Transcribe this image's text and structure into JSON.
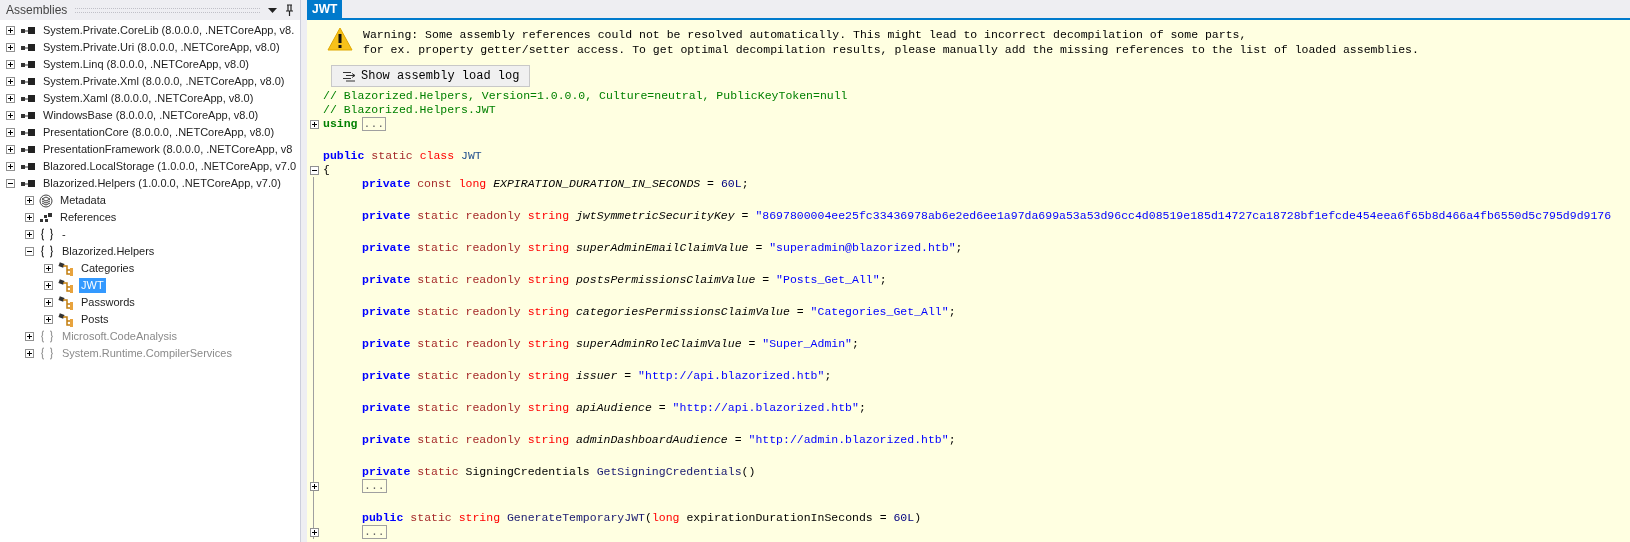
{
  "assemblies_panel": {
    "title": "Assemblies",
    "tree": [
      {
        "label": "System.Private.CoreLib (8.0.0.0, .NETCoreApp, v8.",
        "kind": "assembly",
        "expanded": false,
        "dimmed": false,
        "selected": false
      },
      {
        "label": "System.Private.Uri (8.0.0.0, .NETCoreApp, v8.0)",
        "kind": "assembly",
        "expanded": false,
        "dimmed": false,
        "selected": false
      },
      {
        "label": "System.Linq (8.0.0.0, .NETCoreApp, v8.0)",
        "kind": "assembly",
        "expanded": false,
        "dimmed": false,
        "selected": false
      },
      {
        "label": "System.Private.Xml (8.0.0.0, .NETCoreApp, v8.0)",
        "kind": "assembly",
        "expanded": false,
        "dimmed": false,
        "selected": false
      },
      {
        "label": "System.Xaml (8.0.0.0, .NETCoreApp, v8.0)",
        "kind": "assembly",
        "expanded": false,
        "dimmed": false,
        "selected": false
      },
      {
        "label": "WindowsBase (8.0.0.0, .NETCoreApp, v8.0)",
        "kind": "assembly",
        "expanded": false,
        "dimmed": false,
        "selected": false
      },
      {
        "label": "PresentationCore (8.0.0.0, .NETCoreApp, v8.0)",
        "kind": "assembly",
        "expanded": false,
        "dimmed": false,
        "selected": false
      },
      {
        "label": "PresentationFramework (8.0.0.0, .NETCoreApp, v8",
        "kind": "assembly",
        "expanded": false,
        "dimmed": false,
        "selected": false
      },
      {
        "label": "Blazored.LocalStorage (1.0.0.0, .NETCoreApp, v7.0",
        "kind": "assembly",
        "expanded": false,
        "dimmed": false,
        "selected": false
      },
      {
        "label": "Blazorized.Helpers (1.0.0.0, .NETCoreApp, v7.0)",
        "kind": "assembly",
        "expanded": true,
        "dimmed": false,
        "selected": false,
        "children": [
          {
            "label": "Metadata",
            "kind": "metadata",
            "expanded": false,
            "dimmed": false,
            "selected": false
          },
          {
            "label": "References",
            "kind": "references",
            "expanded": false,
            "dimmed": false,
            "selected": false
          },
          {
            "label": "-",
            "kind": "namespace",
            "expanded": false,
            "dimmed": false,
            "selected": false
          },
          {
            "label": "Blazorized.Helpers",
            "kind": "namespace",
            "expanded": true,
            "dimmed": false,
            "selected": false,
            "children": [
              {
                "label": "Categories",
                "kind": "class",
                "expanded": false,
                "dimmed": false,
                "selected": false
              },
              {
                "label": "JWT",
                "kind": "class",
                "expanded": false,
                "dimmed": false,
                "selected": true
              },
              {
                "label": "Passwords",
                "kind": "class",
                "expanded": false,
                "dimmed": false,
                "selected": false
              },
              {
                "label": "Posts",
                "kind": "class",
                "expanded": false,
                "dimmed": false,
                "selected": false
              }
            ]
          },
          {
            "label": "Microsoft.CodeAnalysis",
            "kind": "namespace",
            "expanded": false,
            "dimmed": true,
            "selected": false
          },
          {
            "label": "System.Runtime.CompilerServices",
            "kind": "namespace",
            "expanded": false,
            "dimmed": true,
            "selected": false
          }
        ]
      }
    ]
  },
  "editor": {
    "tabs": [
      {
        "label": "JWT",
        "selected": true
      }
    ],
    "warning": [
      "Warning: Some assembly references could not be resolved automatically. This might lead to incorrect decompilation of some parts,",
      "for ex. property getter/setter access. To get optimal decompilation results, please manually add the missing references to the list of loaded assemblies."
    ],
    "load_log_button": "Show assembly load log",
    "code": [
      {
        "kind": "code",
        "indented": false,
        "tokens": [
          {
            "text": "// Blazorized.Helpers, Version=1.0.0.0, Culture=neutral, PublicKeyToken=null",
            "kind": "comment"
          }
        ]
      },
      {
        "kind": "code",
        "indented": false,
        "tokens": [
          {
            "text": "// Blazorized.Helpers.JWT",
            "kind": "comment"
          }
        ]
      },
      {
        "kind": "code",
        "indented": false,
        "expanded": false,
        "tokens": [
          {
            "text": "using",
            "kind": "directive"
          }
        ],
        "collapsed": "..."
      },
      {
        "kind": "blank"
      },
      {
        "kind": "code",
        "indented": false,
        "tokens": [
          {
            "text": "public",
            "kind": "keyword"
          },
          {
            "text": " static",
            "kind": "modifier"
          },
          {
            "text": " class",
            "kind": "type"
          },
          {
            "text": " JWT",
            "kind": "typename"
          }
        ]
      },
      {
        "kind": "code",
        "indented": false,
        "expanded": true,
        "tokens": [
          {
            "text": "{",
            "kind": "plain"
          }
        ]
      },
      {
        "kind": "code",
        "indented": true,
        "tokens": [
          {
            "text": "private",
            "kind": "keyword"
          },
          {
            "text": " const",
            "kind": "modifier"
          },
          {
            "text": " long",
            "kind": "type"
          },
          {
            "text": " EXPIRATION_DURATION_IN_SECONDS",
            "kind": "field"
          },
          {
            "text": " = ",
            "kind": "plain"
          },
          {
            "text": "60L",
            "kind": "number"
          },
          {
            "text": ";",
            "kind": "plain"
          }
        ]
      },
      {
        "kind": "blank"
      },
      {
        "kind": "code",
        "indented": true,
        "tokens": [
          {
            "text": "private",
            "kind": "keyword"
          },
          {
            "text": " static readonly",
            "kind": "modifier"
          },
          {
            "text": " string",
            "kind": "type"
          },
          {
            "text": " jwtSymmetricSecurityKey",
            "kind": "field"
          },
          {
            "text": " = ",
            "kind": "plain"
          },
          {
            "text": "\"8697800004ee25fc33436978ab6e2ed6ee1a97da699a53a53d96cc4d08519e185d14727ca18728bf1efcde454eea6f65b8d466a4fb6550d5c795d9d9176",
            "kind": "string"
          }
        ]
      },
      {
        "kind": "blank"
      },
      {
        "kind": "code",
        "indented": true,
        "tokens": [
          {
            "text": "private",
            "kind": "keyword"
          },
          {
            "text": " static readonly",
            "kind": "modifier"
          },
          {
            "text": " string",
            "kind": "type"
          },
          {
            "text": " superAdminEmailClaimValue",
            "kind": "field"
          },
          {
            "text": " = ",
            "kind": "plain"
          },
          {
            "text": "\"superadmin@blazorized.htb\"",
            "kind": "string"
          },
          {
            "text": ";",
            "kind": "plain"
          }
        ]
      },
      {
        "kind": "blank"
      },
      {
        "kind": "code",
        "indented": true,
        "tokens": [
          {
            "text": "private",
            "kind": "keyword"
          },
          {
            "text": " static readonly",
            "kind": "modifier"
          },
          {
            "text": " string",
            "kind": "type"
          },
          {
            "text": " postsPermissionsClaimValue",
            "kind": "field"
          },
          {
            "text": " = ",
            "kind": "plain"
          },
          {
            "text": "\"Posts_Get_All\"",
            "kind": "string"
          },
          {
            "text": ";",
            "kind": "plain"
          }
        ]
      },
      {
        "kind": "blank"
      },
      {
        "kind": "code",
        "indented": true,
        "tokens": [
          {
            "text": "private",
            "kind": "keyword"
          },
          {
            "text": " static readonly",
            "kind": "modifier"
          },
          {
            "text": " string",
            "kind": "type"
          },
          {
            "text": " categoriesPermissionsClaimValue",
            "kind": "field"
          },
          {
            "text": " = ",
            "kind": "plain"
          },
          {
            "text": "\"Categories_Get_All\"",
            "kind": "string"
          },
          {
            "text": ";",
            "kind": "plain"
          }
        ]
      },
      {
        "kind": "blank"
      },
      {
        "kind": "code",
        "indented": true,
        "tokens": [
          {
            "text": "private",
            "kind": "keyword"
          },
          {
            "text": " static readonly",
            "kind": "modifier"
          },
          {
            "text": " string",
            "kind": "type"
          },
          {
            "text": " superAdminRoleClaimValue",
            "kind": "field"
          },
          {
            "text": " = ",
            "kind": "plain"
          },
          {
            "text": "\"Super_Admin\"",
            "kind": "string"
          },
          {
            "text": ";",
            "kind": "plain"
          }
        ]
      },
      {
        "kind": "blank"
      },
      {
        "kind": "code",
        "indented": true,
        "tokens": [
          {
            "text": "private",
            "kind": "keyword"
          },
          {
            "text": " static readonly",
            "kind": "modifier"
          },
          {
            "text": " string",
            "kind": "type"
          },
          {
            "text": " issuer",
            "kind": "field"
          },
          {
            "text": " = ",
            "kind": "plain"
          },
          {
            "text": "\"http://api.blazorized.htb\"",
            "kind": "string"
          },
          {
            "text": ";",
            "kind": "plain"
          }
        ]
      },
      {
        "kind": "blank"
      },
      {
        "kind": "code",
        "indented": true,
        "tokens": [
          {
            "text": "private",
            "kind": "keyword"
          },
          {
            "text": " static readonly",
            "kind": "modifier"
          },
          {
            "text": " string",
            "kind": "type"
          },
          {
            "text": " apiAudience",
            "kind": "field"
          },
          {
            "text": " = ",
            "kind": "plain"
          },
          {
            "text": "\"http://api.blazorized.htb\"",
            "kind": "string"
          },
          {
            "text": ";",
            "kind": "plain"
          }
        ]
      },
      {
        "kind": "blank"
      },
      {
        "kind": "code",
        "indented": true,
        "tokens": [
          {
            "text": "private",
            "kind": "keyword"
          },
          {
            "text": " static readonly",
            "kind": "modifier"
          },
          {
            "text": " string",
            "kind": "type"
          },
          {
            "text": " adminDashboardAudience",
            "kind": "field"
          },
          {
            "text": " = ",
            "kind": "plain"
          },
          {
            "text": "\"http://admin.blazorized.htb\"",
            "kind": "string"
          },
          {
            "text": ";",
            "kind": "plain"
          }
        ]
      },
      {
        "kind": "blank"
      },
      {
        "kind": "code",
        "indented": true,
        "tokens": [
          {
            "text": "private",
            "kind": "keyword"
          },
          {
            "text": " static",
            "kind": "modifier"
          },
          {
            "text": " SigningCredentials",
            "kind": "plain"
          },
          {
            "text": " GetSigningCredentials",
            "kind": "method"
          },
          {
            "text": "()",
            "kind": "plain"
          }
        ]
      },
      {
        "kind": "code",
        "indented": true,
        "expanded": false,
        "collapsed": "..."
      },
      {
        "kind": "blank"
      },
      {
        "kind": "code",
        "indented": true,
        "tokens": [
          {
            "text": "public",
            "kind": "keyword"
          },
          {
            "text": " static",
            "kind": "modifier"
          },
          {
            "text": " string",
            "kind": "type"
          },
          {
            "text": " GenerateTemporaryJWT",
            "kind": "method"
          },
          {
            "text": "(",
            "kind": "plain"
          },
          {
            "text": "long",
            "kind": "type"
          },
          {
            "text": " expirationDurationInSeconds = ",
            "kind": "plain"
          },
          {
            "text": "60L",
            "kind": "number"
          },
          {
            "text": ")",
            "kind": "plain"
          }
        ]
      },
      {
        "kind": "code",
        "indented": true,
        "expanded": false,
        "collapsed": "..."
      }
    ]
  }
}
